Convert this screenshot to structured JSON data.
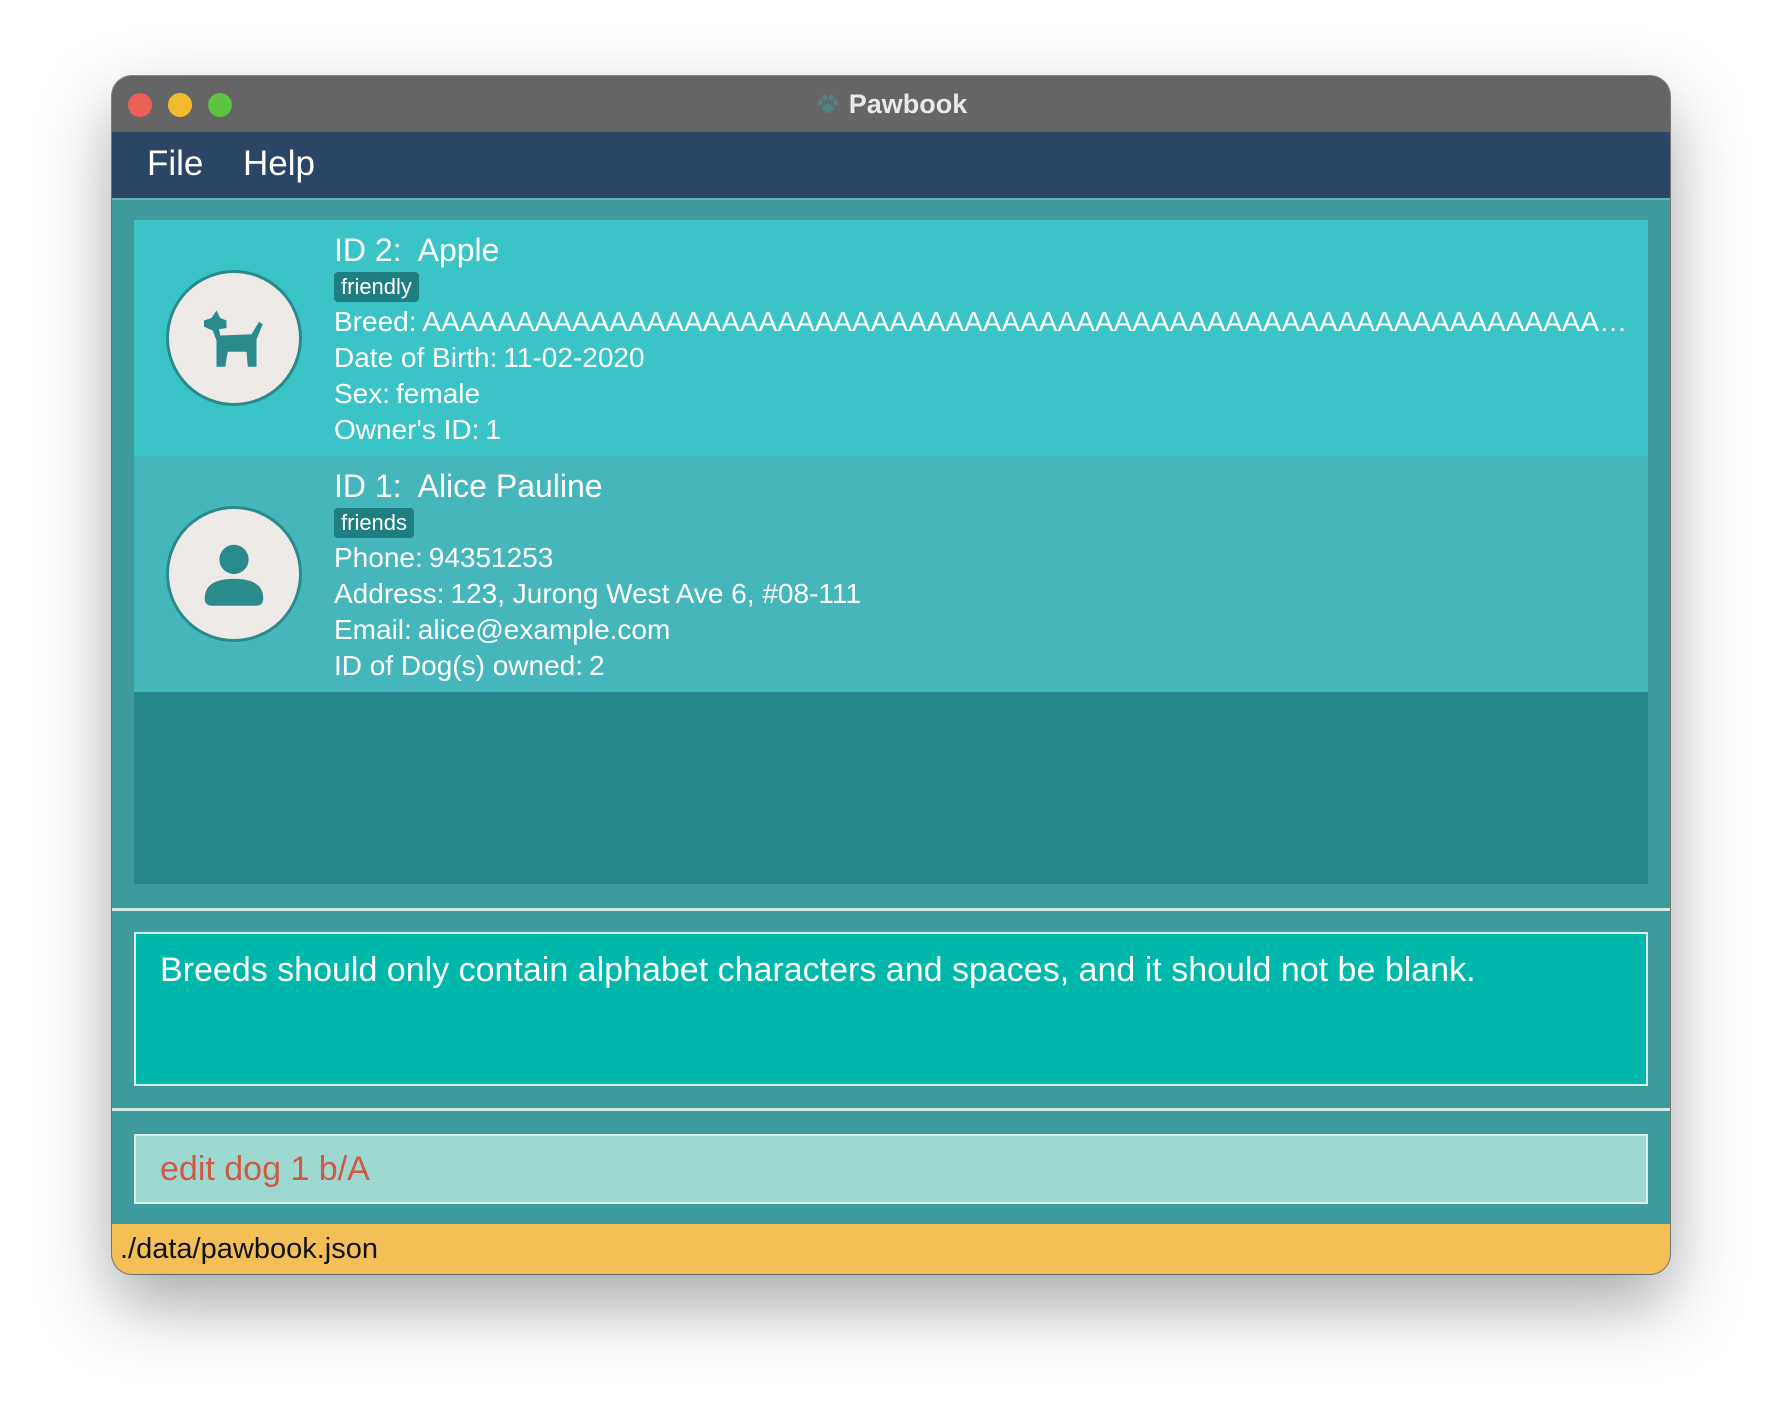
{
  "window": {
    "title": "Pawbook"
  },
  "menu": {
    "items": [
      "File",
      "Help"
    ]
  },
  "list": {
    "cards": [
      {
        "kind": "dog",
        "icon": "dog-icon",
        "id_label": "ID 2:",
        "name": "Apple",
        "tag": "friendly",
        "fields": [
          {
            "label": "Breed:",
            "value": "AAAAAAAAAAAAAAAAAAAAAAAAAAAAAAAAAAAAAAAAAAAAAAAAAAAAAAAAAAAAAAAA..."
          },
          {
            "label": "Date of Birth:",
            "value": "11-02-2020"
          },
          {
            "label": "Sex:",
            "value": "female"
          },
          {
            "label": "Owner's ID:",
            "value": "1"
          }
        ]
      },
      {
        "kind": "owner",
        "icon": "person-icon",
        "id_label": "ID 1:",
        "name": "Alice Pauline",
        "tag": "friends",
        "fields": [
          {
            "label": "Phone:",
            "value": "94351253"
          },
          {
            "label": "Address:",
            "value": "123, Jurong West Ave 6, #08-111"
          },
          {
            "label": "Email:",
            "value": "alice@example.com"
          },
          {
            "label": "ID of Dog(s) owned:",
            "value": "2"
          }
        ]
      }
    ]
  },
  "result": {
    "message": "Breeds should only contain alphabet characters and spaces, and it should not be blank."
  },
  "command": {
    "value": "edit dog 1 b/A"
  },
  "status": {
    "file_path": "./data/pawbook.json"
  },
  "colors": {
    "menubar": "#2a4566",
    "card_selected": "#3ac4c7",
    "card": "#46b6bd",
    "result_box": "#00b7ac",
    "command_box": "#9dd9d1",
    "command_text_error": "#cf5a43",
    "statusbar": "#f4bf57"
  }
}
